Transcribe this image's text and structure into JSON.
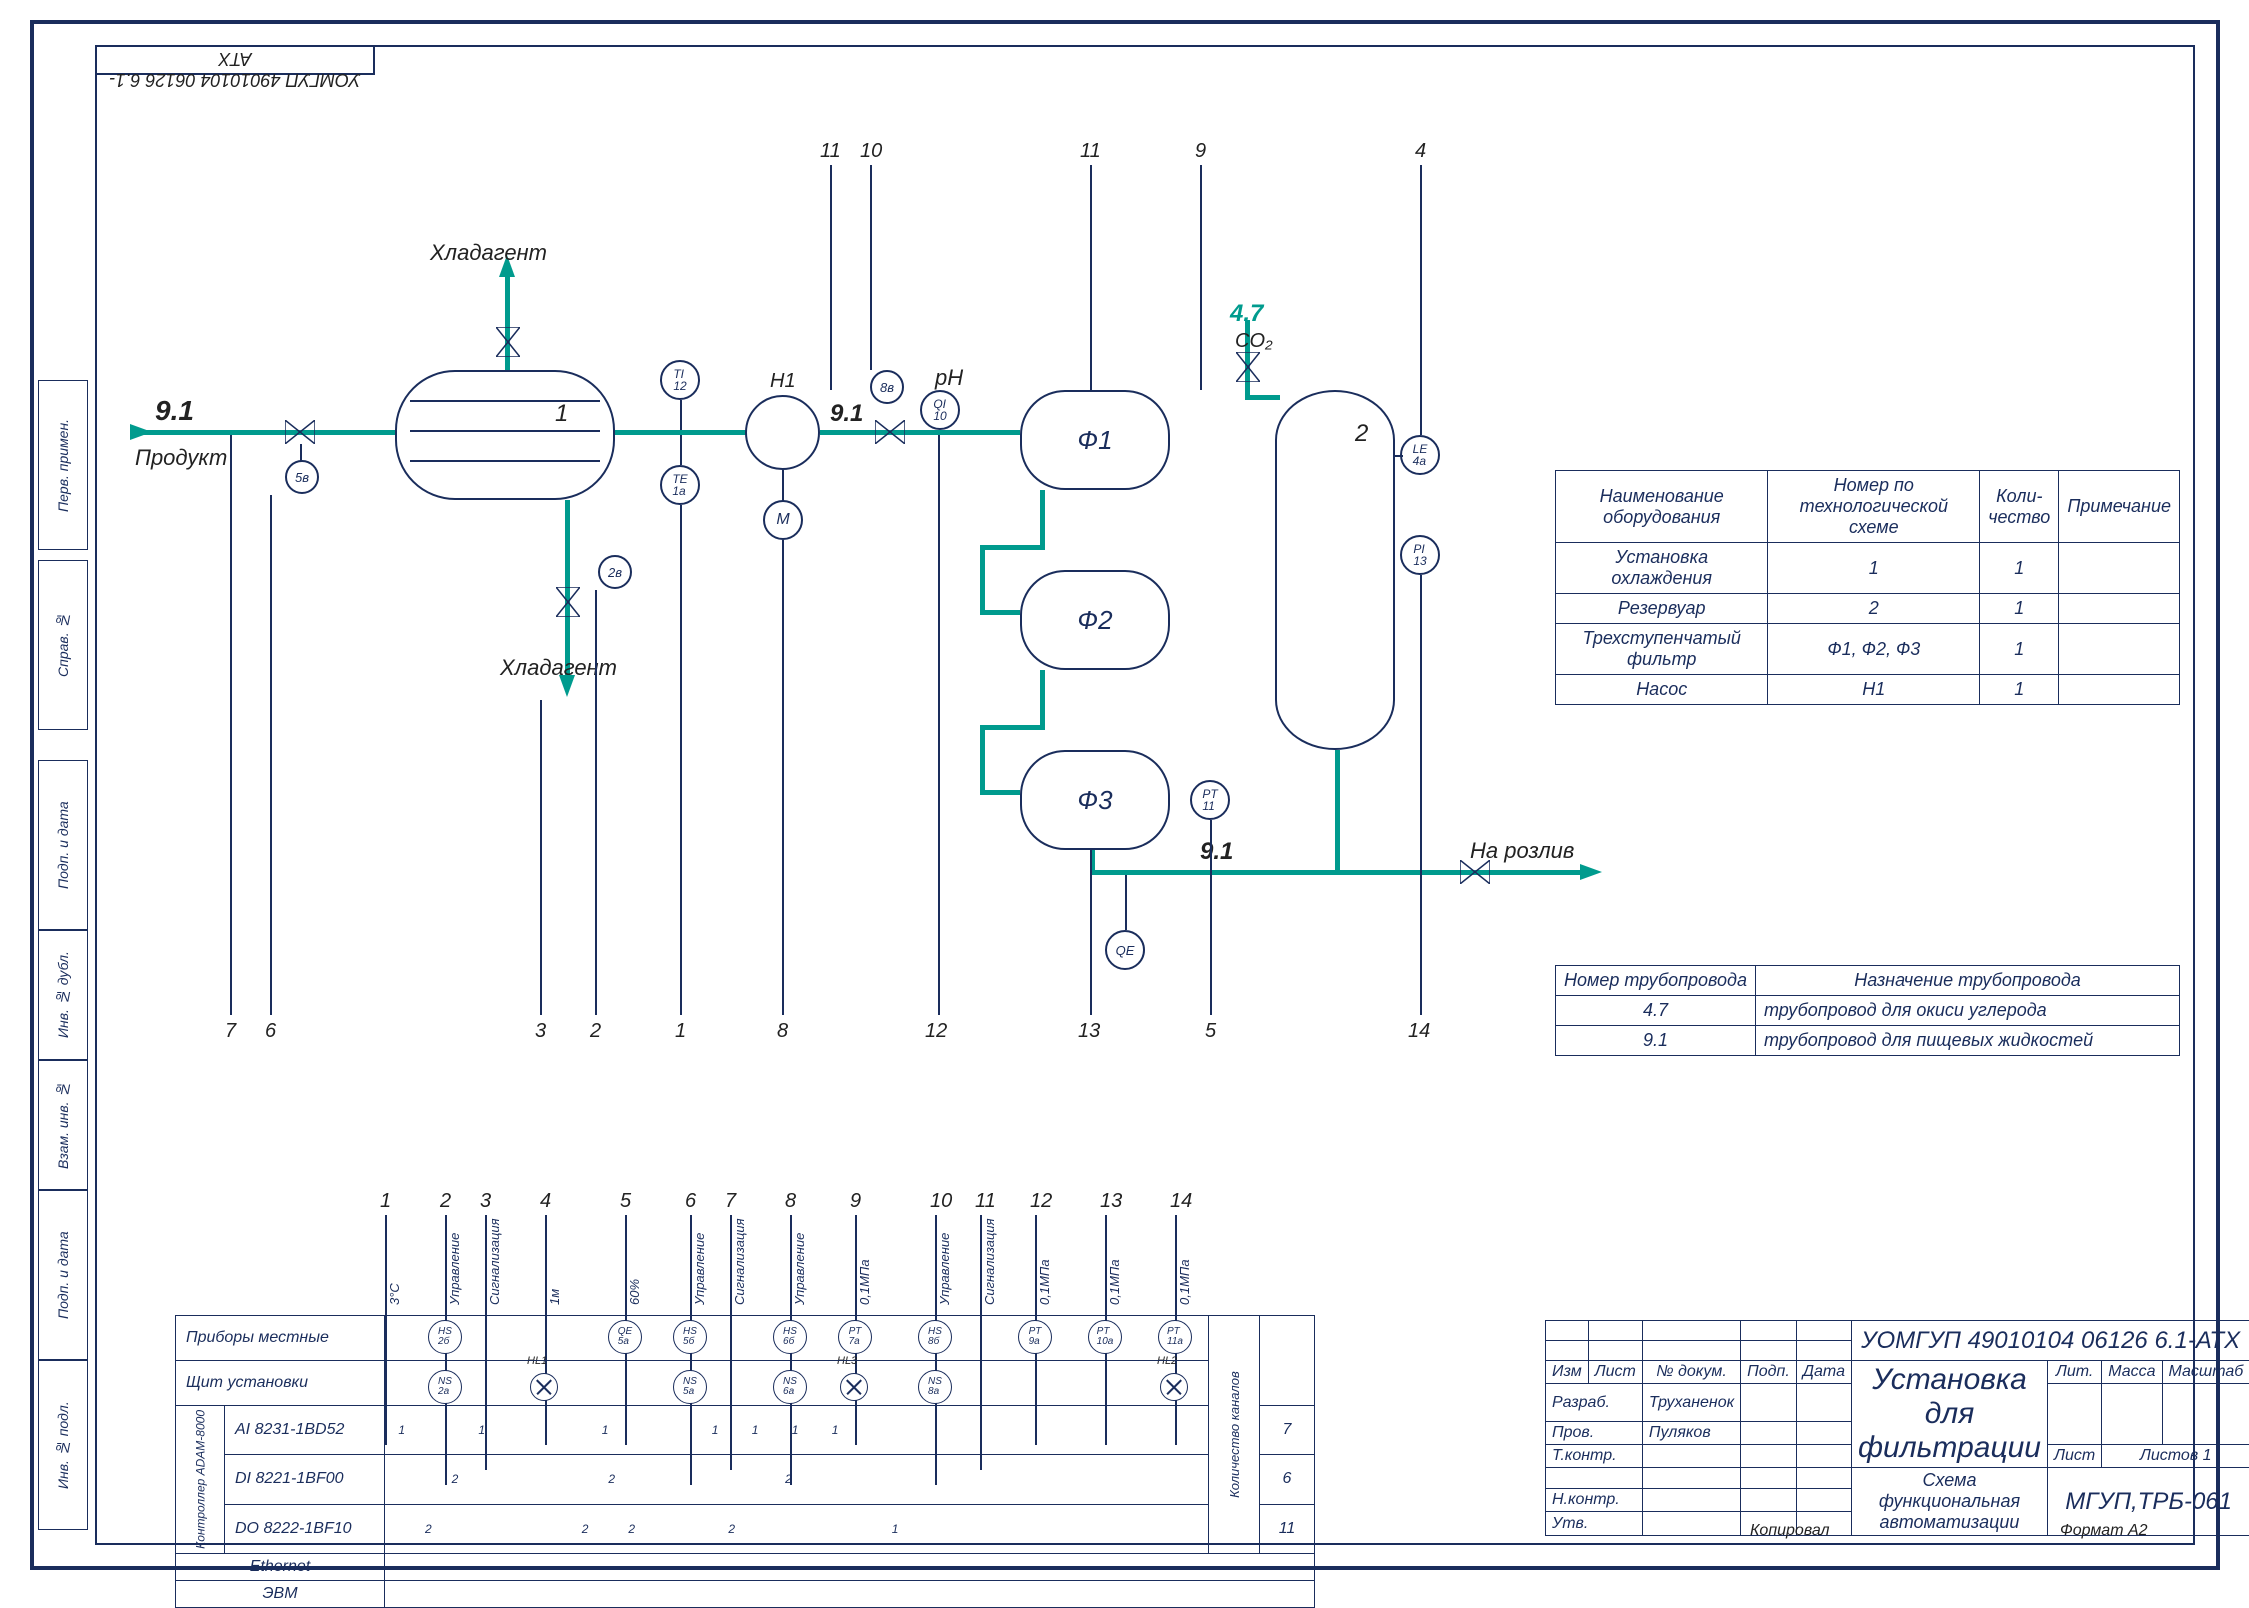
{
  "drawing_number": "УОМГУП 49010104 06126 6.1-АТХ",
  "labels": {
    "product": "Продукт",
    "refrigerant": "Хладагент",
    "to_bottling": "На розлив",
    "ph": "pH",
    "co2": "CO₂"
  },
  "flows": {
    "product": "9.1",
    "co2": "4.7"
  },
  "equipment_tags": {
    "h1": "Н1",
    "f1": "Ф1",
    "f2": "Ф2",
    "f3": "Ф3",
    "n1": "1",
    "n2": "2"
  },
  "equip_table": {
    "headers": {
      "c1": "Наименование оборудования",
      "c2": "Номер по технологической схеме",
      "c3": "Коли-чество",
      "c4": "Примечание"
    },
    "rows": [
      {
        "c1": "Установка охлаждения",
        "c2": "1",
        "c3": "1",
        "c4": ""
      },
      {
        "c1": "Резервуар",
        "c2": "2",
        "c3": "1",
        "c4": ""
      },
      {
        "c1": "Трехступенчатый фильтр",
        "c2": "Ф1, Ф2, Ф3",
        "c3": "1",
        "c4": ""
      },
      {
        "c1": "Насос",
        "c2": "Н1",
        "c3": "1",
        "c4": ""
      }
    ]
  },
  "pipe_table": {
    "headers": {
      "c1": "Номер трубопровода",
      "c2": "Назначение трубопровода"
    },
    "rows": [
      {
        "c1": "4.7",
        "c2": "трубопровод для окиси углерода"
      },
      {
        "c1": "9.1",
        "c2": "трубопровод для пищевых жидкостей"
      }
    ]
  },
  "io_table": {
    "rows": [
      {
        "label": "Приборы местные"
      },
      {
        "label": "Щит установки"
      },
      {
        "label": "AI 8231-1BD52",
        "end": "7"
      },
      {
        "label": "DI 8221-1BF00",
        "end": "6"
      },
      {
        "label": "DO 8222-1BF10",
        "end": "11"
      },
      {
        "label": "Ethernet"
      },
      {
        "label": "ЭВМ"
      }
    ],
    "side_label": "Контроллер ADAM-8000",
    "count_label": "Количество каналов"
  },
  "channels": [
    "1",
    "2",
    "3",
    "4",
    "5",
    "6",
    "7",
    "8",
    "9",
    "10",
    "11",
    "12",
    "13",
    "14"
  ],
  "channel_texts": [
    "3°C",
    "Управление",
    "Сигнализация",
    "1м",
    "60%",
    "Управление",
    "Сигнализация",
    "Управление",
    "0,1МПа",
    "Управление",
    "Сигнализация",
    "0,1МПа",
    "0,1МПа",
    "0,1МПа"
  ],
  "instruments": {
    "ti12": "TI\n12",
    "te1a": "TE\n1а",
    "m": "M",
    "qi10": "QI\n10",
    "le4a": "LE\n4а",
    "pi13": "PI\n13",
    "pt11": "PT\n11",
    "qe": "QE",
    "v5": "5в",
    "v2": "2в",
    "v8": "8в"
  },
  "titleblock": {
    "code": "УОМГУП 49010104 06126 6.1-АТХ",
    "title1": "Установка для",
    "title2": "фильтрации",
    "subtitle": "Схема функциональная автоматизации",
    "org": "МГУП,ТРБ-061",
    "format": "Формат  А2",
    "list": "Лист",
    "lists": "Листов   1",
    "lit": "Лит.",
    "mass": "Масса",
    "scale": "Масштаб",
    "roles": {
      "izm": "Изм",
      "list": "Лист",
      "ndoc": "№ докум.",
      "podp": "Подп.",
      "data": "Дата",
      "razrab": "Разраб.",
      "prov": "Пров.",
      "tcontr": "Т.контр.",
      "ncontr": "Н.контр.",
      "utv": "Утв."
    },
    "names": {
      "razrab": "Труханенок",
      "prov": "Пуляков"
    },
    "kopiroval": "Копировал"
  },
  "sidebar": {
    "c1": "Инв. № подл.",
    "c2": "Подп. и дата",
    "c3": "Взам. инв. №",
    "c4": "Инв. № дубл.",
    "c5": "Подп. и дата",
    "c6": "Справ. №",
    "c7": "Перв. примен."
  },
  "bottom_nums": [
    "7",
    "6",
    "3",
    "2",
    "1",
    "8",
    "12",
    "13",
    "5",
    "14"
  ],
  "top_nums": [
    "11",
    "10",
    "11",
    "9",
    "4"
  ]
}
